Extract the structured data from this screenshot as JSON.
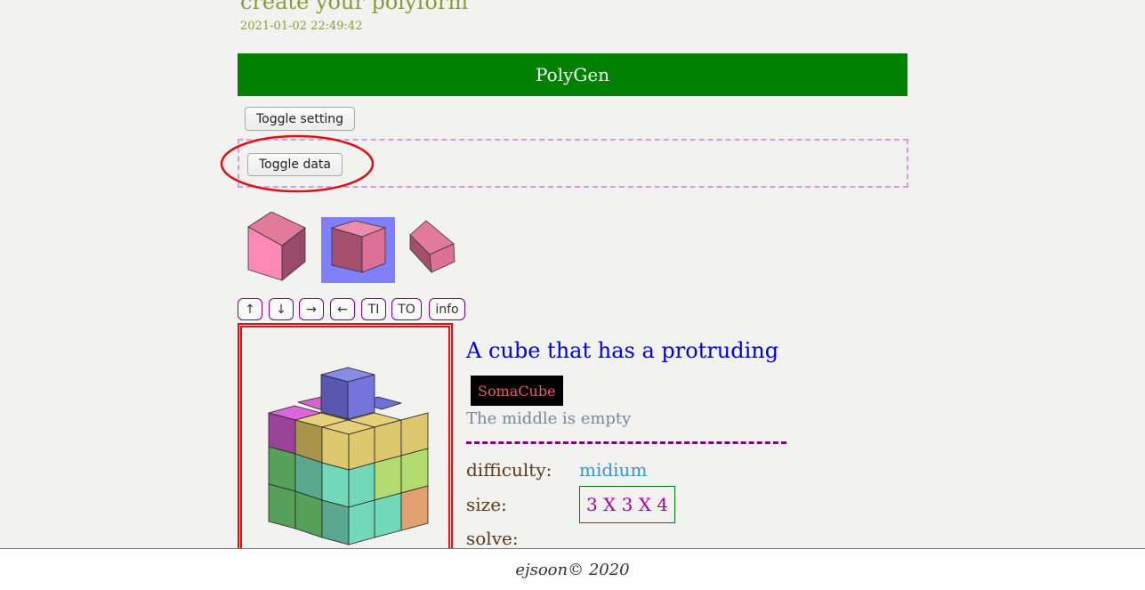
{
  "header": {
    "title": "create your polyform",
    "timestamp": "2021-01-02 22:49:42"
  },
  "app": {
    "name": "PolyGen",
    "bar_color": "#008000"
  },
  "controls": {
    "toggle_setting_label": "Toggle setting",
    "toggle_data_label": "Toggle data",
    "highlight_color": "#e01010"
  },
  "thumbnails": [
    {
      "name": "cube-view-front",
      "selected": false
    },
    {
      "name": "cube-view-angled",
      "selected": true
    },
    {
      "name": "cube-view-tilted",
      "selected": false
    }
  ],
  "nav_buttons": [
    {
      "label": "↑"
    },
    {
      "label": "↓"
    },
    {
      "label": "→"
    },
    {
      "label": "←"
    },
    {
      "label": "TI"
    },
    {
      "label": "TO"
    },
    {
      "label": "info"
    }
  ],
  "puzzle": {
    "title": "A cube that has a protruding",
    "tag": "SomaCube",
    "description": "The middle is empty",
    "difficulty_label": "difficulty:",
    "difficulty_value": "midium",
    "size_label": "size:",
    "size_value": "3 X 3 X 4",
    "solve_label": "solve:"
  },
  "footer": {
    "text": "ejsoon© 2020"
  }
}
